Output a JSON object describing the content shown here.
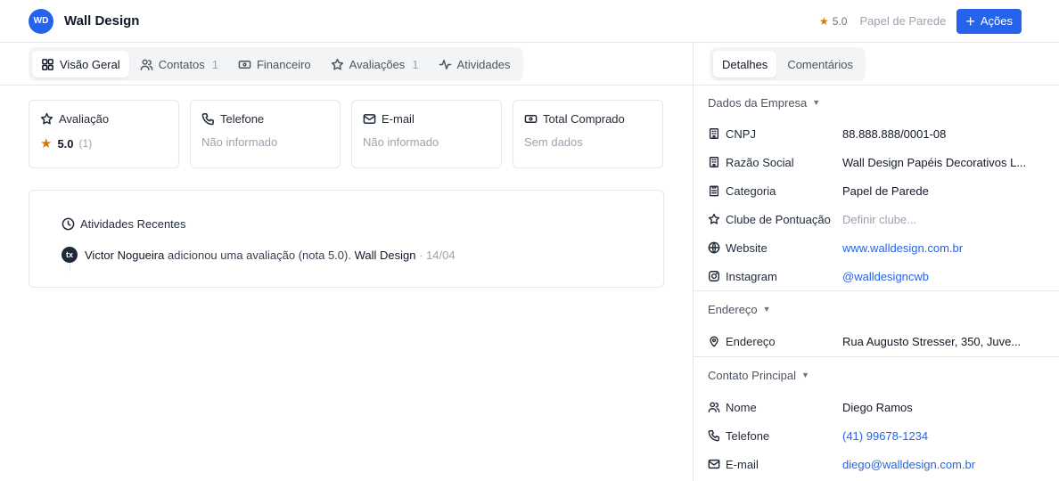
{
  "header": {
    "avatar_initials": "WD",
    "title": "Wall Design",
    "rating": "5.0",
    "category": "Papel de Parede",
    "actions_label": "Ações"
  },
  "tabs": [
    {
      "label": "Visão Geral",
      "count": "",
      "icon": "grid-icon",
      "active": true
    },
    {
      "label": "Contatos",
      "count": "1",
      "icon": "users-icon",
      "active": false
    },
    {
      "label": "Financeiro",
      "count": "",
      "icon": "money-icon",
      "active": false
    },
    {
      "label": "Avaliações",
      "count": "1",
      "icon": "star-icon",
      "active": false
    },
    {
      "label": "Atividades",
      "count": "",
      "icon": "activity-icon",
      "active": false
    }
  ],
  "cards": {
    "rating": {
      "label": "Avaliação",
      "value": "5.0",
      "count": "(1)"
    },
    "phone": {
      "label": "Telefone",
      "value": "Não informado"
    },
    "email": {
      "label": "E-mail",
      "value": "Não informado"
    },
    "purchased": {
      "label": "Total Comprado",
      "value": "Sem dados"
    }
  },
  "activity": {
    "title": "Atividades Recentes",
    "items": [
      {
        "badge": "tx",
        "user": "Victor Nogueira",
        "action": "adicionou uma avaliação (nota 5.0).",
        "target": "Wall Design",
        "date": "· 14/04"
      }
    ]
  },
  "right_tabs": [
    {
      "label": "Detalhes",
      "active": true
    },
    {
      "label": "Comentários",
      "active": false
    }
  ],
  "company": {
    "title": "Dados da Empresa",
    "rows": [
      {
        "label": "CNPJ",
        "value": "88.888.888/0001-08",
        "icon": "building-icon"
      },
      {
        "label": "Razão Social",
        "value": "Wall Design Papéis Decorativos L...",
        "icon": "building-icon"
      },
      {
        "label": "Categoria",
        "value": "Papel de Parede",
        "icon": "clipboard-icon"
      },
      {
        "label": "Clube de Pontuação",
        "value": "Definir clube...",
        "icon": "star-icon"
      },
      {
        "label": "Website",
        "value": "www.walldesign.com.br",
        "icon": "globe-icon"
      },
      {
        "label": "Instagram",
        "value": "@walldesigncwb",
        "icon": "instagram-icon"
      }
    ]
  },
  "address": {
    "title": "Endereço",
    "rows": [
      {
        "label": "Endereço",
        "value": "Rua Augusto Stresser, 350, Juve...",
        "icon": "map-pin-icon"
      }
    ]
  },
  "contact": {
    "title": "Contato Principal",
    "rows": [
      {
        "label": "Nome",
        "value": "Diego Ramos",
        "icon": "users-icon"
      },
      {
        "label": "Telefone",
        "value": "(41) 99678-1234",
        "icon": "phone-icon"
      },
      {
        "label": "E-mail",
        "value": "diego@walldesign.com.br",
        "icon": "mail-icon"
      }
    ]
  },
  "colors": {
    "accent": "#2563eb",
    "star": "#d97706",
    "border": "#e5e7eb"
  }
}
